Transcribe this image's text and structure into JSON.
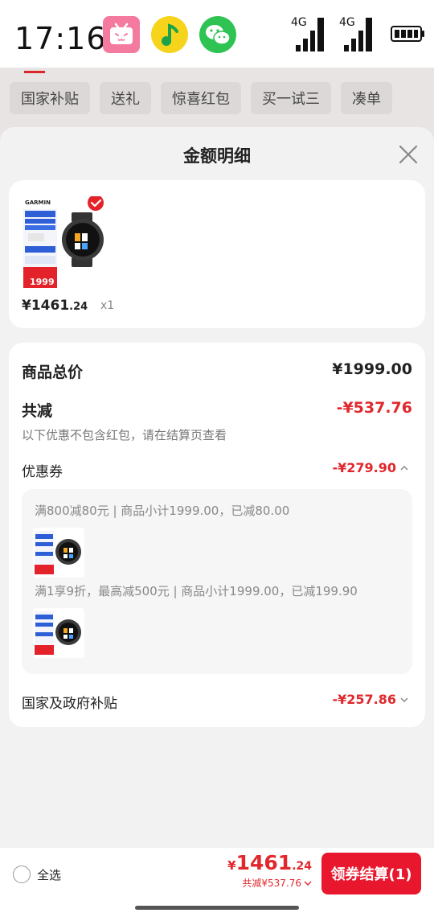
{
  "status_bar": {
    "time": "17:16",
    "apps": [
      "bilibili-icon",
      "qq-music-icon",
      "wechat-icon"
    ],
    "signal1_label": "4G",
    "signal2_label": "4G"
  },
  "background": {
    "tabs": [
      "国家补贴",
      "送礼",
      "惊喜红包",
      "买一试三",
      "凑单"
    ]
  },
  "sheet": {
    "title": "金额明细",
    "product": {
      "image_brand": "GARMIN",
      "image_price": "1999",
      "price_symbol": "¥",
      "price_int": "1461",
      "price_dec": ".24",
      "qty": "x1"
    },
    "detail": {
      "total_label": "商品总价",
      "total_value": "¥1999.00",
      "discount_label": "共减",
      "discount_value": "-¥537.76",
      "note": "以下优惠不包含红包，请在结算页查看",
      "coupon_label": "优惠券",
      "coupon_value": "-¥279.90",
      "coupon_items": [
        {
          "desc": "满800减80元 | 商品小计1999.00，已减80.00"
        },
        {
          "desc": "满1享9折，最高减500元 | 商品小计1999.00，已减199.90"
        }
      ],
      "subsidy_label": "国家及政府补贴",
      "subsidy_value": "-¥257.86"
    }
  },
  "bottom_bar": {
    "select_all": "全选",
    "total_symbol": "¥",
    "total_int": "1461",
    "total_dec": ".24",
    "saved": "共减¥537.76",
    "checkout": "领券结算(1)"
  },
  "colors": {
    "accent_red": "#e0282d",
    "button_red": "#e8172e"
  }
}
